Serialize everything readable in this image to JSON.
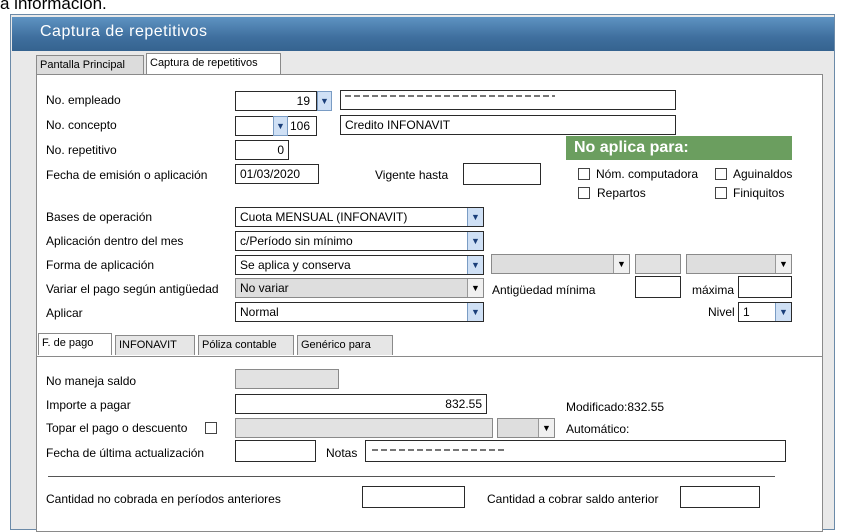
{
  "header_text": "a información.",
  "window": {
    "title": "Captura de repetitivos"
  },
  "main_tabs": [
    "Pantalla Principal",
    "Captura de repetitivos"
  ],
  "form": {
    "no_empleado": {
      "label": "No. empleado",
      "value": "19"
    },
    "no_concepto": {
      "label": "No. concepto",
      "value": "106",
      "description": "Credito INFONAVIT"
    },
    "no_repetitivo": {
      "label": "No. repetitivo",
      "value": "0"
    },
    "fecha_emision": {
      "label": "Fecha de emisión o aplicación",
      "value": "01/03/2020"
    },
    "vigente_hasta": {
      "label": "Vigente hasta",
      "value": ""
    },
    "bases_operacion": {
      "label": "Bases de operación",
      "value": "Cuota MENSUAL (INFONAVIT)"
    },
    "aplicacion_mes": {
      "label": "Aplicación dentro del mes",
      "value": "c/Período sin mínimo"
    },
    "forma_aplicacion": {
      "label": "Forma de aplicación",
      "value": "Se aplica y conserva"
    },
    "variar_pago": {
      "label": "Variar el pago según antigüedad",
      "value": "No variar"
    },
    "antiguedad_minima": {
      "label": "Antigüedad mínima",
      "value": ""
    },
    "maxima": {
      "label": "máxima",
      "value": ""
    },
    "aplicar": {
      "label": "Aplicar",
      "value": "Normal"
    },
    "nivel": {
      "label": "Nivel",
      "value": "1"
    }
  },
  "no_aplica": {
    "title": "No aplica para:",
    "options": [
      {
        "label": "Nóm. computadora",
        "checked": false
      },
      {
        "label": "Aguinaldos",
        "checked": false
      },
      {
        "label": "Repartos",
        "checked": false
      },
      {
        "label": "Finiquitos",
        "checked": false
      }
    ]
  },
  "sub_tabs": [
    "F. de pago",
    "INFONAVIT",
    "Póliza contable",
    "Genérico para"
  ],
  "pago": {
    "no_maneja_saldo": {
      "label": "No maneja saldo",
      "value": ""
    },
    "importe": {
      "label": "Importe a pagar",
      "value": "832.55"
    },
    "modificado": "Modificado:832.55",
    "topar": {
      "label": "Topar el pago o descuento",
      "checked": false
    },
    "automatico": "Automático:",
    "fecha_actualizacion": {
      "label": "Fecha de última actualización",
      "value": ""
    },
    "notas": {
      "label": "Notas",
      "value": ""
    },
    "cantidad_no_cobrada": {
      "label": "Cantidad no cobrada en períodos anteriores",
      "value": ""
    },
    "cantidad_cobrar": {
      "label": "Cantidad a cobrar saldo anterior",
      "value": ""
    }
  },
  "colors": {
    "title_bar": "#4a7fb0",
    "no_aplica_bg": "#6b9e5f",
    "spin_button": "#cfe0f5"
  },
  "icons": {
    "dropdown": "chevron-down-icon"
  }
}
